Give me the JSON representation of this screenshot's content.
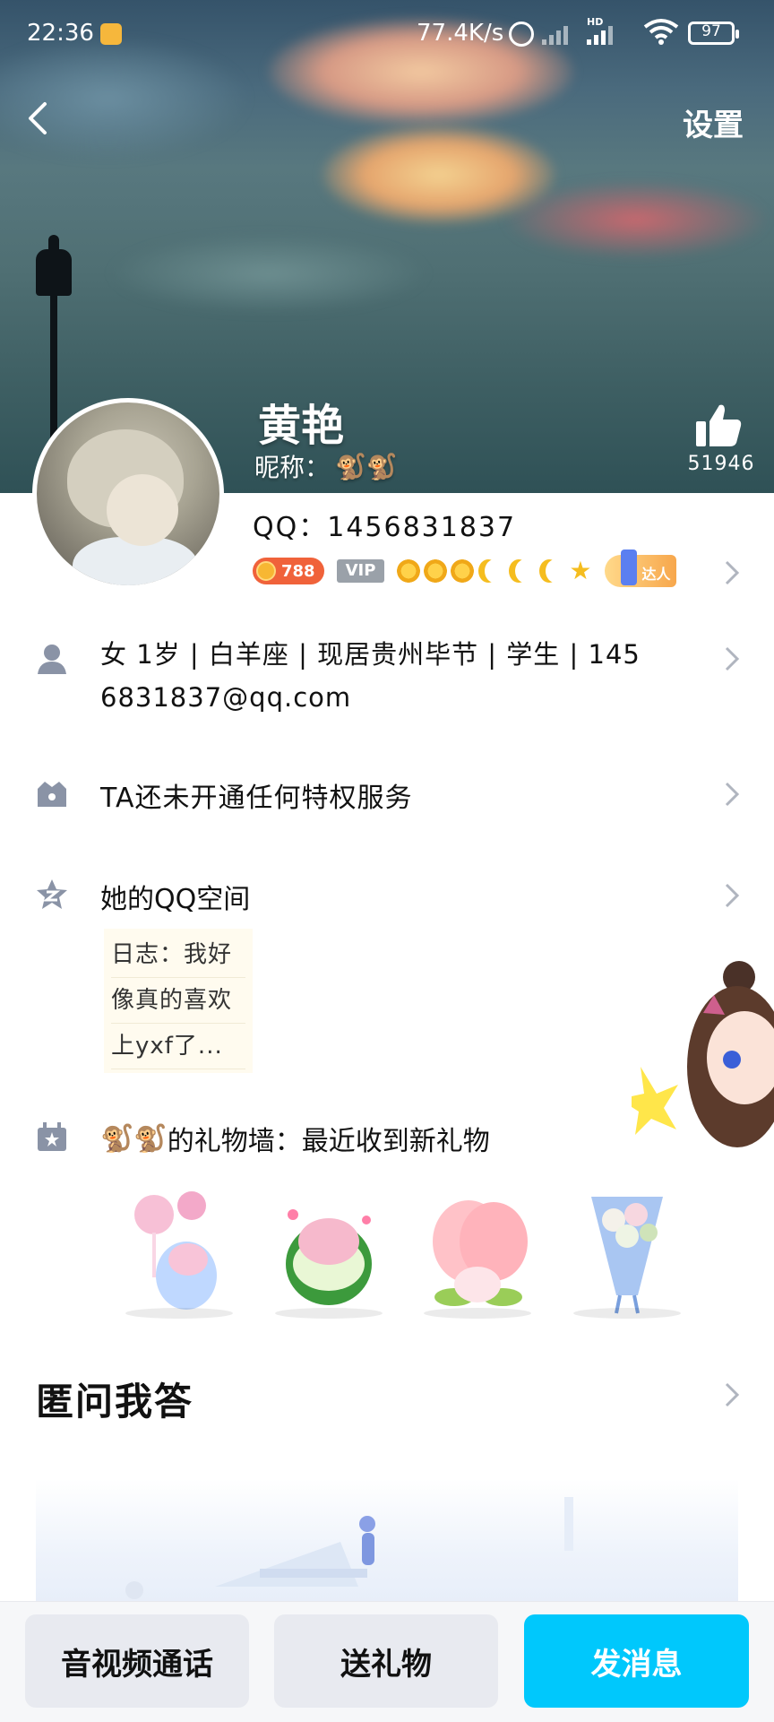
{
  "status_bar": {
    "time": "22:36",
    "net_speed": "77.4K/s",
    "network_label": "HD",
    "battery": "97"
  },
  "header": {
    "settings_label": "设置"
  },
  "profile": {
    "name": "黄艳",
    "nickname_label": "昵称：",
    "nickname_emoji": "🐒🐒",
    "like_count": "51946",
    "qq_line": "QQ：1456831837",
    "coin_level": "788",
    "vip_label": "VIP",
    "daren_label": "达人"
  },
  "details": {
    "text": "女 | 1岁 | 白羊座 | 现居贵州毕节 | 学生 | 1456831837@qq.com",
    "display_line1": "女  1岁  |  白羊座  |  现居贵州毕节  |  学生  |  145",
    "display_line2": "6831837@qq.com"
  },
  "privilege": {
    "text": "TA还未开通任何特权服务"
  },
  "qzone": {
    "title": "她的QQ空间",
    "lines": [
      "日志：我好",
      "像真的喜欢",
      "上yxf了..."
    ]
  },
  "gift_wall": {
    "owner_emoji": "🐒🐒",
    "title": "的礼物墙：最近收到新礼物",
    "gifts": [
      {
        "name": "lollipop-pig-gift"
      },
      {
        "name": "watermelon-pig-gift"
      },
      {
        "name": "peach-gift"
      },
      {
        "name": "bouquet-gift"
      }
    ]
  },
  "anon_qa": {
    "title": "匿问我答"
  },
  "bottom_bar": {
    "call_label": "音视频通话",
    "gift_label": "送礼物",
    "message_label": "发消息"
  },
  "colors": {
    "accent_blue": "#00c8fc",
    "coin_orange": "#f0623a",
    "vip_grey": "#9aa1a9",
    "icon_grey": "#8a93a6",
    "chevron_grey": "#b0b5bf"
  }
}
